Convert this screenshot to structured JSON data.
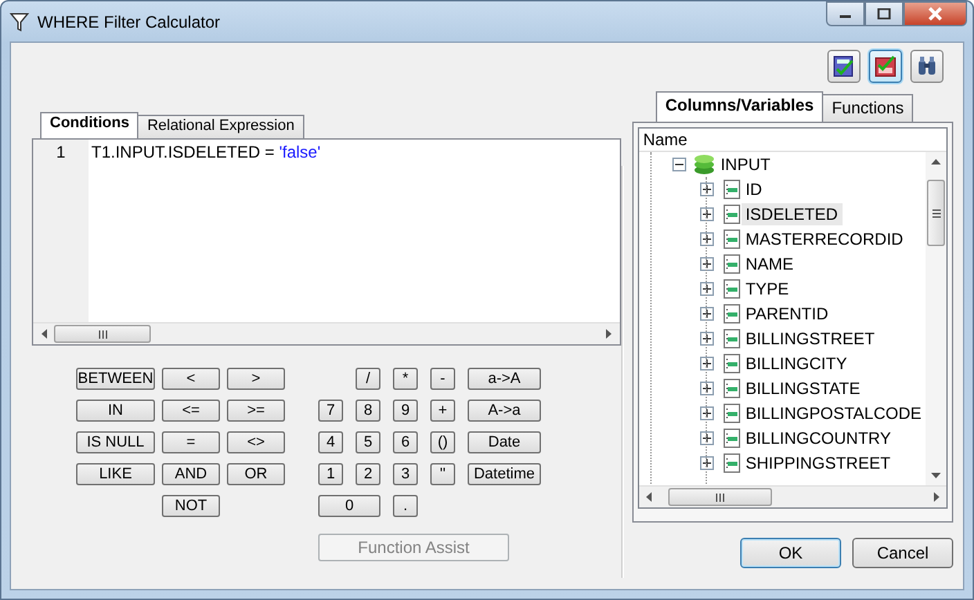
{
  "window": {
    "title": "WHERE Filter Calculator"
  },
  "toolbar_buttons": [
    {
      "pressed": false
    },
    {
      "pressed": true
    },
    {
      "pressed": false
    }
  ],
  "editor_tabs": [
    {
      "label": "Conditions",
      "selected": true
    },
    {
      "label": "Relational Expression",
      "selected": false
    }
  ],
  "editor": {
    "lines": [
      {
        "number": "1",
        "tokens": [
          {
            "kind": "plain",
            "text": "T1.INPUT.ISDELETED = "
          },
          {
            "kind": "string",
            "text": "'false'"
          }
        ]
      }
    ]
  },
  "operator_rows": [
    [
      "BETWEEN",
      "<",
      ">"
    ],
    [
      "IN",
      "<=",
      ">="
    ],
    [
      "IS NULL",
      "=",
      "<>"
    ],
    [
      "LIKE",
      "AND",
      "OR"
    ],
    [
      "NOT"
    ]
  ],
  "keypad_rows": [
    [
      "/",
      "*",
      "-",
      "a->A"
    ],
    [
      "7",
      "8",
      "9",
      "+",
      "A->a"
    ],
    [
      "4",
      "5",
      "6",
      "()",
      "Date"
    ],
    [
      "1",
      "2",
      "3",
      "''",
      "Datetime"
    ],
    [
      "0",
      "."
    ]
  ],
  "function_assist": {
    "label": "Function Assist",
    "disabled": true
  },
  "side_tabs": [
    {
      "label": "Columns/Variables",
      "selected": true
    },
    {
      "label": "Functions",
      "selected": false
    }
  ],
  "tree": {
    "header": "Name",
    "items": [
      {
        "label": "INPUT",
        "expanded": true,
        "selected": false,
        "children": [
          {
            "label": "ID",
            "expanded": false,
            "selected": false
          },
          {
            "label": "ISDELETED",
            "expanded": false,
            "selected": true
          },
          {
            "label": "MASTERRECORDID",
            "expanded": false,
            "selected": false
          },
          {
            "label": "NAME",
            "expanded": false,
            "selected": false
          },
          {
            "label": "TYPE",
            "expanded": false,
            "selected": false
          },
          {
            "label": "PARENTID",
            "expanded": false,
            "selected": false
          },
          {
            "label": "BILLINGSTREET",
            "expanded": false,
            "selected": false
          },
          {
            "label": "BILLINGCITY",
            "expanded": false,
            "selected": false
          },
          {
            "label": "BILLINGSTATE",
            "expanded": false,
            "selected": false
          },
          {
            "label": "BILLINGPOSTALCODE",
            "expanded": false,
            "selected": false
          },
          {
            "label": "BILLINGCOUNTRY",
            "expanded": false,
            "selected": false
          },
          {
            "label": "SHIPPINGSTREET",
            "expanded": false,
            "selected": false
          }
        ]
      }
    ]
  },
  "dialog_buttons": [
    {
      "label": "OK",
      "kind": "default"
    },
    {
      "label": "Cancel",
      "kind": "normal"
    }
  ]
}
